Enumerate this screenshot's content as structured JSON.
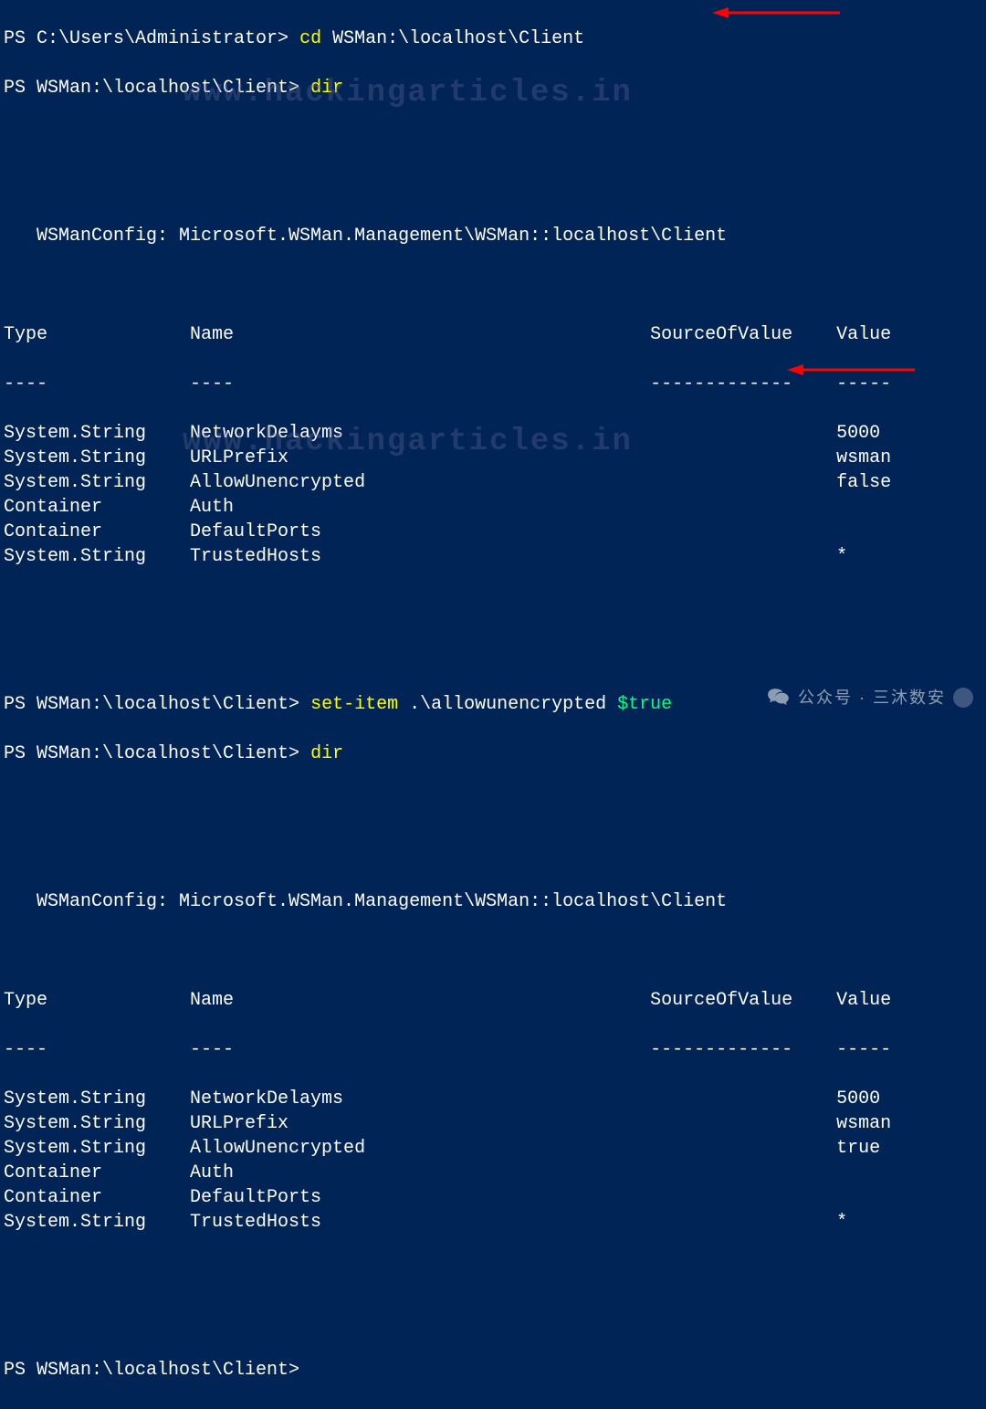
{
  "watermark": "www.hackingarticles.in",
  "footer": "公众号 · 三沐数安",
  "lines": {
    "l1_prompt": "PS C:\\Users\\Administrator> ",
    "l1_cmd": "cd ",
    "l1_arg": "WSMan:\\localhost\\Client",
    "l2_prompt": "PS WSMan:\\localhost\\Client> ",
    "l2_cmd": "dir",
    "cfg1": "   WSManConfig: Microsoft.WSMan.Management\\WSMan::localhost\\Client",
    "hdr_type": "Type",
    "hdr_name": "Name",
    "hdr_src": "SourceOfValue",
    "hdr_val": "Value",
    "dash_type": "----",
    "dash_name": "----",
    "dash_src": "-------------",
    "dash_val": "-----",
    "l3_prompt": "PS WSMan:\\localhost\\Client> ",
    "l3_cmd": "set-item ",
    "l3_arg1": ".\\allowunencrypted ",
    "l3_arg2": "$true",
    "l4_prompt": "PS WSMan:\\localhost\\Client> ",
    "l4_cmd": "dir",
    "cfg2": "   WSManConfig: Microsoft.WSMan.Management\\WSMan::localhost\\Client",
    "last_prompt": "PS WSMan:\\localhost\\Client>"
  },
  "table1": [
    {
      "type": "System.String",
      "name": "NetworkDelayms",
      "src": "",
      "val": "5000"
    },
    {
      "type": "System.String",
      "name": "URLPrefix",
      "src": "",
      "val": "wsman"
    },
    {
      "type": "System.String",
      "name": "AllowUnencrypted",
      "src": "",
      "val": "false"
    },
    {
      "type": "Container",
      "name": "Auth",
      "src": "",
      "val": ""
    },
    {
      "type": "Container",
      "name": "DefaultPorts",
      "src": "",
      "val": ""
    },
    {
      "type": "System.String",
      "name": "TrustedHosts",
      "src": "",
      "val": "*"
    }
  ],
  "table2": [
    {
      "type": "System.String",
      "name": "NetworkDelayms",
      "src": "",
      "val": "5000"
    },
    {
      "type": "System.String",
      "name": "URLPrefix",
      "src": "",
      "val": "wsman"
    },
    {
      "type": "System.String",
      "name": "AllowUnencrypted",
      "src": "",
      "val": "true"
    },
    {
      "type": "Container",
      "name": "Auth",
      "src": "",
      "val": ""
    },
    {
      "type": "Container",
      "name": "DefaultPorts",
      "src": "",
      "val": ""
    },
    {
      "type": "System.String",
      "name": "TrustedHosts",
      "src": "",
      "val": "*"
    }
  ],
  "columns": {
    "type_w": 17,
    "name_w": 42,
    "src_w": 17,
    "val_w": 6
  }
}
